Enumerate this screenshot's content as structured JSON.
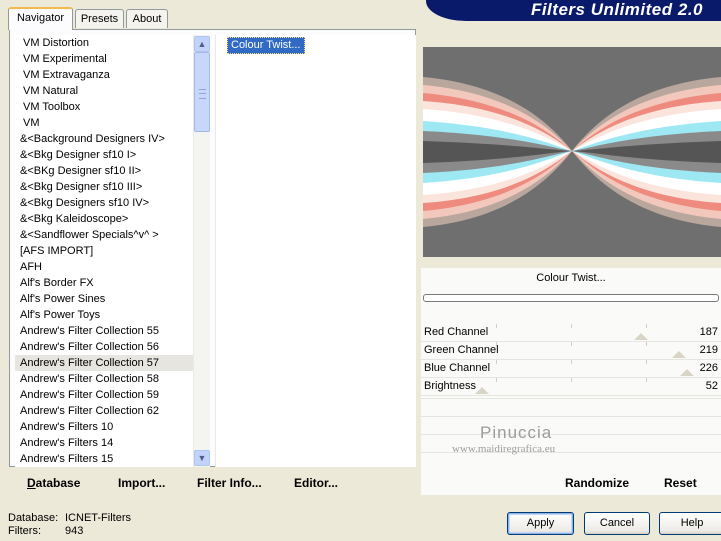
{
  "tabs": [
    {
      "label": "Navigator"
    },
    {
      "label": "Presets"
    },
    {
      "label": "About"
    }
  ],
  "banner": {
    "title": "Filters Unlimited 2.0",
    "bg_color": "#0a1a6b"
  },
  "filter_categories": [
    "VM Distortion",
    "VM Experimental",
    "VM Extravaganza",
    "VM Natural",
    "VM Toolbox",
    "VM",
    "&<Background Designers IV>",
    "&<Bkg Designer sf10 I>",
    "&<BKg Designer sf10 II>",
    "&<Bkg Designer sf10 III>",
    "&<Bkg Designers sf10 IV>",
    "&<Bkg Kaleidoscope>",
    "&<Sandflower Specials^v^ >",
    "[AFS IMPORT]",
    "AFH",
    "Alf's Border FX",
    "Alf's Power Sines",
    "Alf's Power Toys",
    "Andrew's Filter Collection 55",
    "Andrew's Filter Collection 56",
    "Andrew's Filter Collection 57",
    "Andrew's Filter Collection 58",
    "Andrew's Filter Collection 59",
    "Andrew's Filter Collection 62",
    "Andrew's Filters 10",
    "Andrew's Filters 14",
    "Andrew's Filters 15"
  ],
  "selected_category_index": 20,
  "filters": [
    "Colour Twist..."
  ],
  "left_buttons": {
    "database": "Database",
    "import": "Import...",
    "filter_info": "Filter Info...",
    "editor": "Editor..."
  },
  "current_filter": "Colour Twist...",
  "controls": [
    {
      "label": "Red Channel",
      "value": "187",
      "level": 187
    },
    {
      "label": "Green Channel",
      "value": "219",
      "level": 219
    },
    {
      "label": "Blue Channel",
      "value": "226",
      "level": 226
    },
    {
      "label": "Brightness",
      "value": "52",
      "level": 52
    }
  ],
  "control_max": 255,
  "right_buttons": {
    "randomize": "Randomize",
    "reset": "Reset"
  },
  "watermark": {
    "name": "Pinuccia",
    "url": "www.maidiregrafica.eu"
  },
  "status": {
    "database_label": "Database:",
    "database_value": "ICNET-Filters",
    "filters_label": "Filters:",
    "filters_value": "943"
  },
  "dialog_buttons": {
    "apply": "Apply",
    "cancel": "Cancel",
    "help": "Help"
  },
  "colors": {
    "selection": "#316ac5",
    "tab_highlight": "#f2b94f",
    "window_bg": "#ece9d8"
  }
}
